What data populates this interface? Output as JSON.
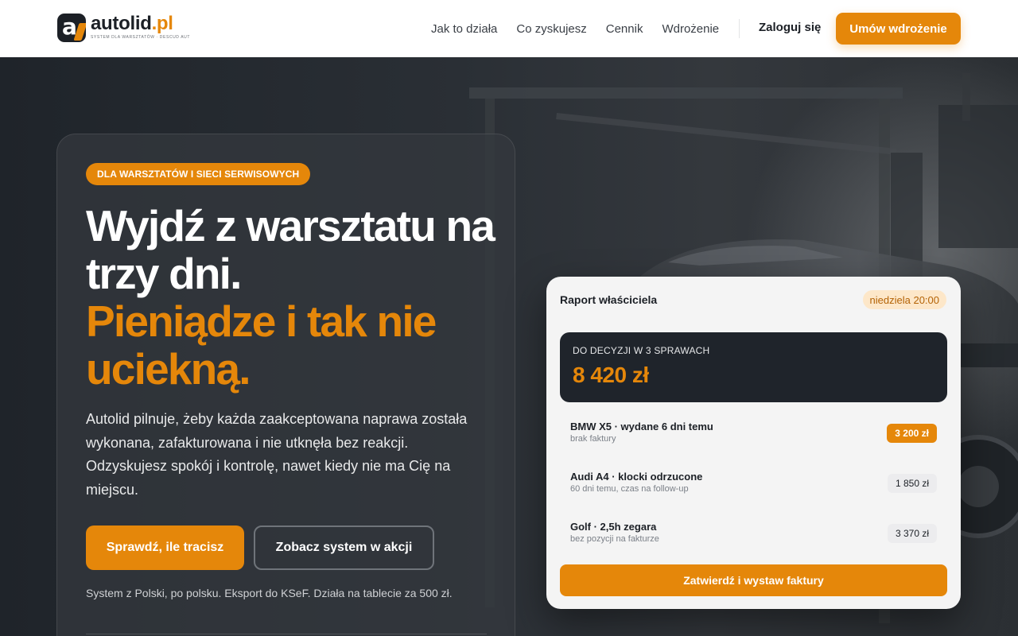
{
  "header": {
    "logo": {
      "word": "autolid",
      "tld": ".pl",
      "tagline": "SYSTEM DLA WARSZTATÓW · DESCUD AUT"
    },
    "nav": [
      {
        "label": "Jak to działa"
      },
      {
        "label": "Co zyskujesz"
      },
      {
        "label": "Cennik"
      },
      {
        "label": "Wdrożenie"
      }
    ],
    "login_label": "Zaloguj się",
    "cta_label": "Umów wdrożenie"
  },
  "hero": {
    "badge": "DLA WARSZTATÓW I SIECI SERWISOWYCH",
    "headline_white": "Wyjdź z warsztatu na trzy dni.",
    "headline_accent": "Pieniądze i tak nie uciekną.",
    "lead": "Autolid pilnuje, żeby każda zaakceptowana naprawa została wykonana, zafakturowana i nie utknęła bez reakcji. Odzyskujesz spokój i kontrolę, nawet kiedy nie ma Cię na miejscu.",
    "primary_button": "Sprawdź, ile tracisz",
    "secondary_button": "Zobacz system w akcji",
    "note": "System z Polski, po polsku. Eksport do KSeF. Działa na tablecie za 500 zł."
  },
  "report": {
    "title": "Raport właściciela",
    "date": "niedziela 20:00",
    "decision_label": "DO DECYZJI W 3 SPRAWACH",
    "decision_amount": "8 420 zł",
    "items": [
      {
        "title": "BMW X5 · wydane 6 dni temu",
        "sub": "brak faktury",
        "amount": "3 200 zł",
        "highlight": true
      },
      {
        "title": "Audi A4 · klocki odrzucone",
        "sub": "60 dni temu, czas na follow-up",
        "amount": "1 850 zł",
        "highlight": false
      },
      {
        "title": "Golf · 2,5h zegara",
        "sub": "bez pozycji na fakturze",
        "amount": "3 370 zł",
        "highlight": false
      }
    ],
    "approve_label": "Zatwierdź i wystaw faktury"
  },
  "colors": {
    "accent": "#e5870a",
    "dark": "#1c2026",
    "header_bg": "#ffffff",
    "report_bg": "#f4f4f4"
  }
}
